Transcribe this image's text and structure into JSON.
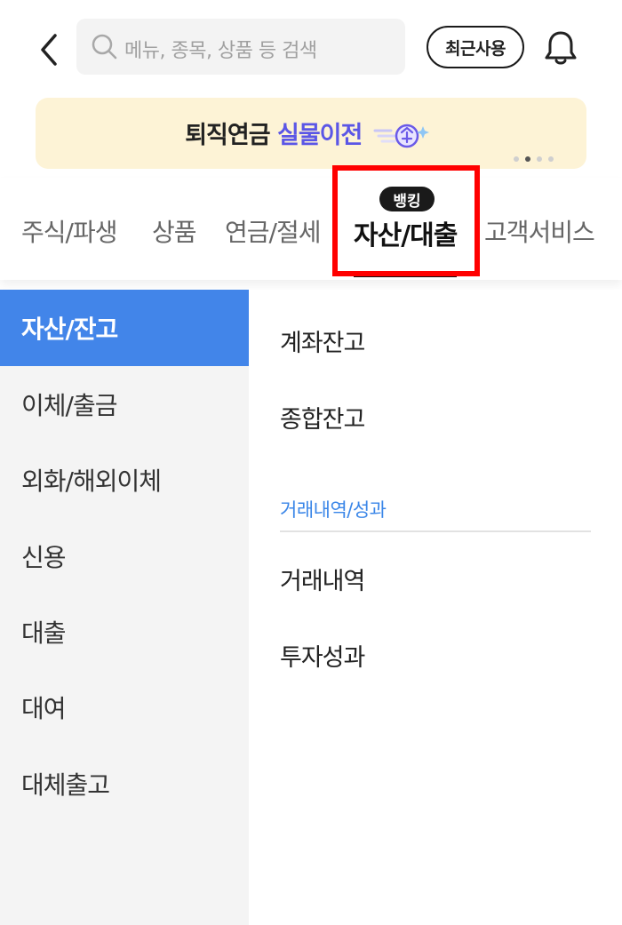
{
  "header": {
    "search_placeholder": "메뉴, 종목, 상품 등 검색",
    "recent_label": "최근사용",
    "icons": {
      "back": "chevron-left-icon",
      "search": "search-icon",
      "bell": "bell-icon"
    }
  },
  "banner": {
    "text_part1": "퇴직연금",
    "text_part2": "실물이전",
    "highlight_color": "#5b56e6",
    "background": "#fdf3d6",
    "slides_total": 4,
    "slide_current": 2
  },
  "tabs": {
    "items": [
      {
        "label": "주식/파생"
      },
      {
        "label": "상품"
      },
      {
        "label": "연금/절세"
      },
      {
        "label": "자산/대출"
      },
      {
        "label": "고객서비스"
      }
    ],
    "active_index": 3,
    "active_badge": "뱅킹",
    "highlight_color": "#ff0000"
  },
  "sidebar": {
    "items": [
      {
        "label": "자산/잔고"
      },
      {
        "label": "이체/출금"
      },
      {
        "label": "외화/해외이체"
      },
      {
        "label": "신용"
      },
      {
        "label": "대출"
      },
      {
        "label": "대여"
      },
      {
        "label": "대체출고"
      }
    ],
    "active_index": 0,
    "active_color": "#4285e9"
  },
  "content": {
    "items_top": [
      {
        "label": "계좌잔고"
      },
      {
        "label": "종합잔고"
      }
    ],
    "section_label": "거래내역/성과",
    "section_color": "#3a86e8",
    "items_section": [
      {
        "label": "거래내역"
      },
      {
        "label": "투자성과"
      }
    ]
  }
}
